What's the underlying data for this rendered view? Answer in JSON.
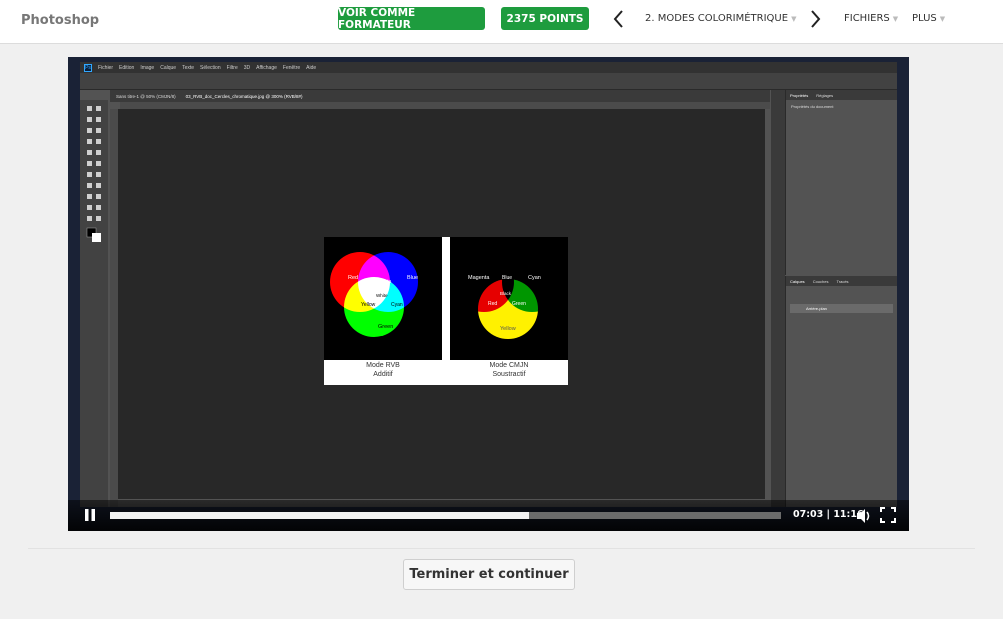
{
  "header": {
    "app_title": "Photoshop",
    "trainer_button": "VOIR COMME FORMATEUR",
    "points_button": "2375 POINTS",
    "module_label": "2. MODES COLORIMÉTRIQUE",
    "files_label": "FICHIERS",
    "more_label": "PLUS"
  },
  "photoshop": {
    "menu": [
      "Fichier",
      "Edition",
      "Image",
      "Calque",
      "Texte",
      "Sélection",
      "Filtre",
      "3D",
      "Affichage",
      "Fenêtre",
      "Aide"
    ],
    "tabs": [
      "Sans titre-1 @ 50% (CMJN/8)",
      "03_RVB_doc_Cercles_chromatique.jpg @ 300% (RVB/8#)"
    ],
    "properties_tabs": [
      "Propriétés",
      "Réglages"
    ],
    "properties_title": "Propriétés du document",
    "layers_tabs": [
      "Calques",
      "Couches",
      "Tracés"
    ],
    "layer_name": "Arrière-plan",
    "image": {
      "rgb": {
        "circles": [
          "Red",
          "Blue",
          "Green"
        ],
        "overlaps": [
          "Magenta",
          "Cyan",
          "Yellow",
          "White"
        ],
        "caption_line1": "Mode RVB",
        "caption_line2": "Additif"
      },
      "cmyk": {
        "circles": [
          "Magenta",
          "Cyan",
          "Yellow"
        ],
        "overlaps": [
          "Blue",
          "Red",
          "Green",
          "Black"
        ],
        "caption_line1": "Mode CMJN",
        "caption_line2": "Soustractif"
      }
    }
  },
  "player": {
    "time": "07:03 | 11:16",
    "progress_fraction": 0.625
  },
  "footer": {
    "finish_button": "Terminer et continuer"
  },
  "colors": {
    "accent_green": "#1e9c3e"
  }
}
